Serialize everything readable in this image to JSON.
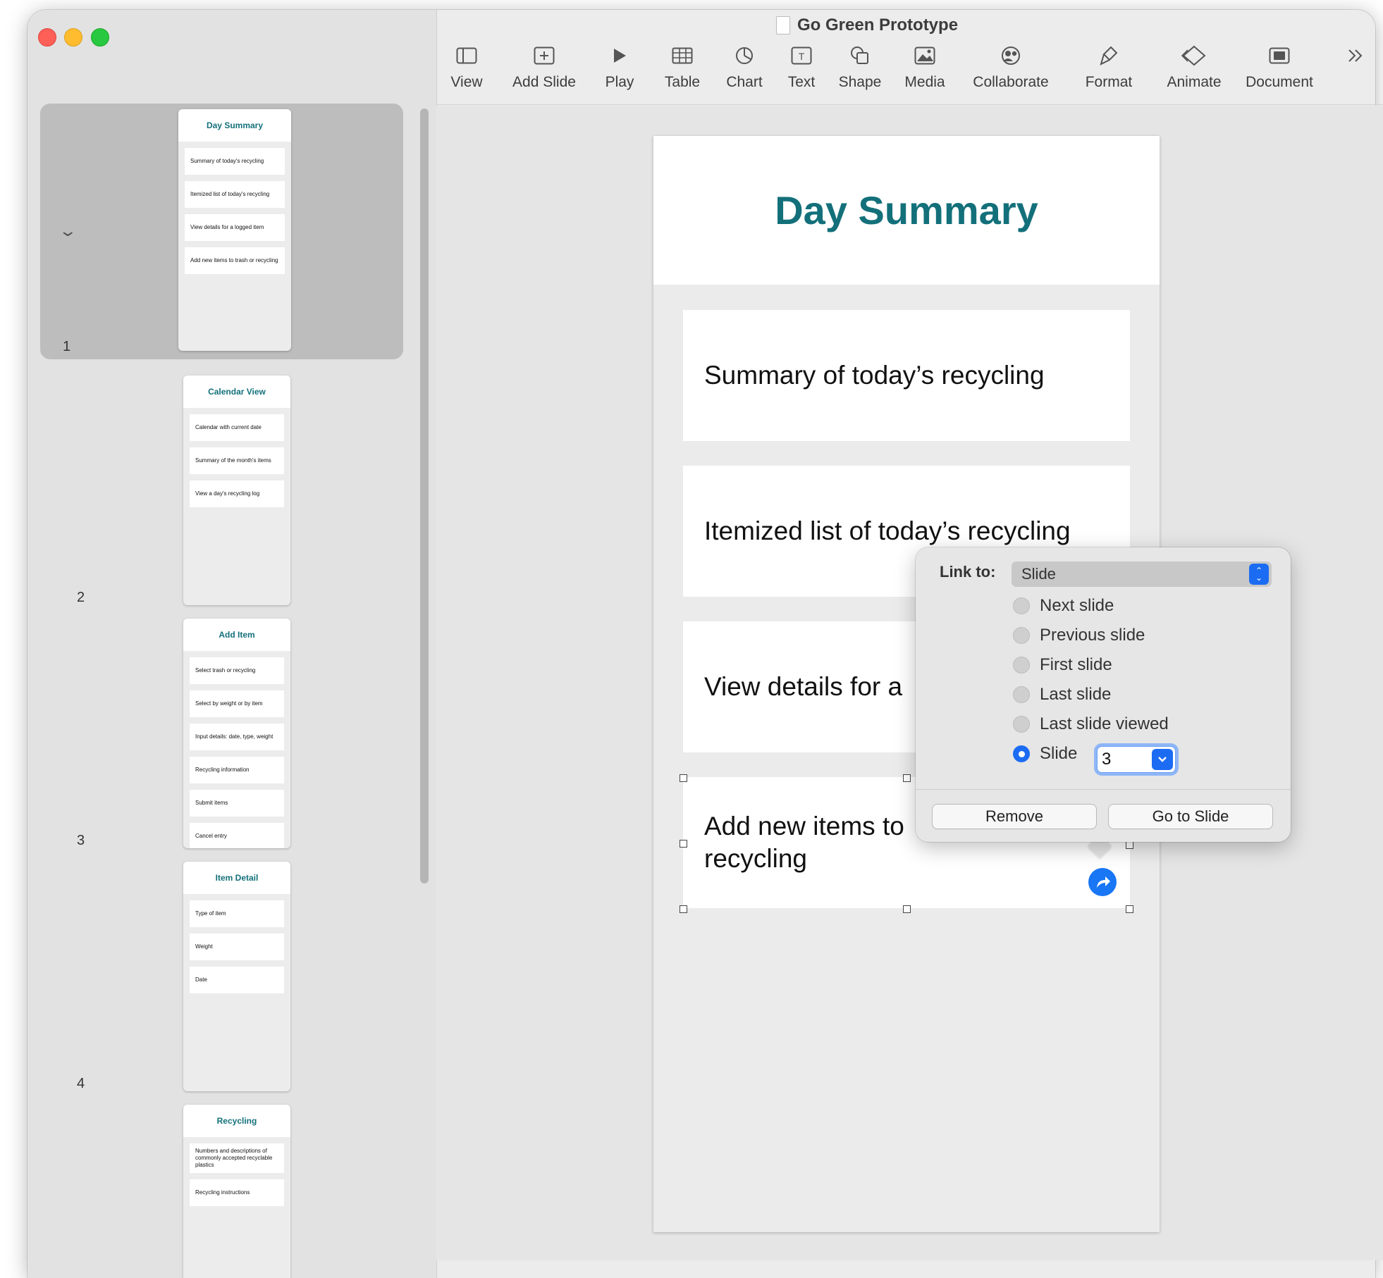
{
  "window": {
    "title": "Go Green Prototype"
  },
  "toolbar": {
    "items": [
      {
        "label": "View",
        "icon": "sidebar-view-icon"
      },
      {
        "label": "Add Slide",
        "icon": "add-slide-icon"
      },
      {
        "label": "Play",
        "icon": "play-icon"
      },
      {
        "label": "Table",
        "icon": "table-icon"
      },
      {
        "label": "Chart",
        "icon": "chart-icon"
      },
      {
        "label": "Text",
        "icon": "text-box-icon"
      },
      {
        "label": "Shape",
        "icon": "shape-icon"
      },
      {
        "label": "Media",
        "icon": "media-icon"
      },
      {
        "label": "Collaborate",
        "icon": "collaborate-icon"
      },
      {
        "label": "Format",
        "icon": "format-brush-icon"
      },
      {
        "label": "Animate",
        "icon": "animate-icon"
      },
      {
        "label": "Document",
        "icon": "document-icon"
      }
    ],
    "overflow_icon": "chevron-double-right-icon"
  },
  "navigator": {
    "slides": [
      {
        "number": "1",
        "title": "Day Summary",
        "items": [
          "Summary of today's recycling",
          "Itemized list of today's recycling",
          "View details for a logged item",
          "Add new items to trash or recycling"
        ]
      },
      {
        "number": "2",
        "title": "Calendar View",
        "items": [
          "Calendar with current date",
          "Summary of the month's items",
          "View a day's recycling log"
        ]
      },
      {
        "number": "3",
        "title": "Add Item",
        "items": [
          "Select trash or recycling",
          "Select by weight or by item",
          "Input details: date, type, weight",
          "Recycling information",
          "Submit items",
          "Cancel entry"
        ]
      },
      {
        "number": "4",
        "title": "Item Detail",
        "items": [
          "Type of item",
          "Weight",
          "Date"
        ]
      },
      {
        "number": "",
        "title": "Recycling",
        "items": [
          "Numbers and descriptions of commonly accepted recyclable plastics",
          "Recycling instructions"
        ]
      }
    ]
  },
  "slide": {
    "title": "Day Summary",
    "items": [
      "Summary of today’s recycling",
      "Itemized list of today’s recycling",
      "View details for a",
      "Add new items to recycling"
    ]
  },
  "link_popover": {
    "label": "Link to:",
    "selected": "Slide",
    "options": [
      "Next slide",
      "Previous slide",
      "First slide",
      "Last slide viewed",
      "Slide"
    ],
    "options_all": [
      "Next slide",
      "Previous slide",
      "First slide",
      "Last slide",
      "Last slide viewed",
      "Slide"
    ],
    "checked": "Slide",
    "slide_number": "3",
    "remove_label": "Remove",
    "go_label": "Go to Slide"
  },
  "colors": {
    "accent": "#1b6cf2",
    "title_teal": "#13707a"
  }
}
